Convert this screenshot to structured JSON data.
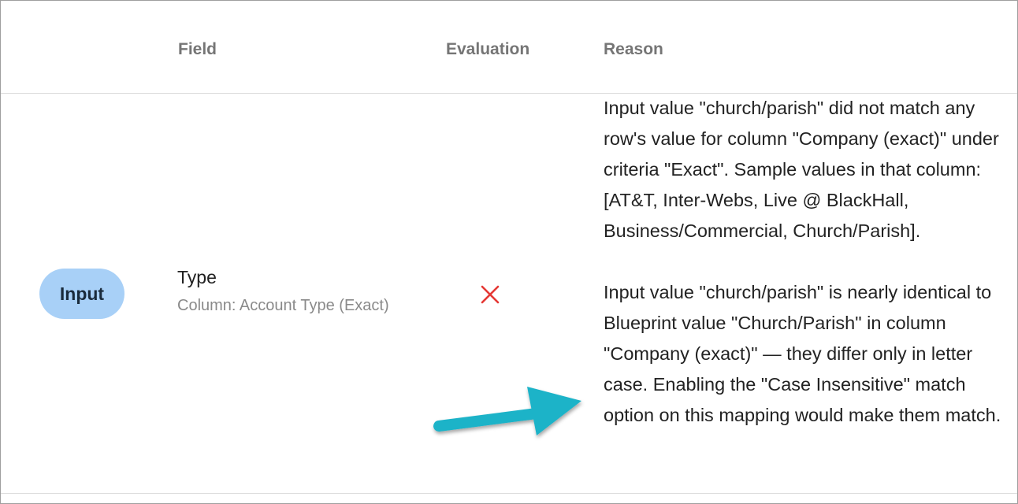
{
  "table": {
    "headers": {
      "field": "Field",
      "evaluation": "Evaluation",
      "reason": "Reason"
    },
    "rows": [
      {
        "badge": "Input",
        "field_name": "Type",
        "field_sub": "Column: Account Type (Exact)",
        "evaluation_icon": "x-icon",
        "evaluation_color": "#e53935",
        "reason_paragraphs": [
          "Input value \"church/parish\" did not match any row's value for column \"Company (exact)\" under criteria \"Exact\". Sample values in that column: [AT&T, Inter-Webs, Live @ BlackHall, Business/Commercial, Church/Parish].",
          "Input value \"church/parish\" is nearly identical to Blueprint value \"Church/Parish\" in column \"Company (exact)\" — they differ only in letter case. Enabling the \"Case Insensitive\" match option on this mapping would make them match."
        ]
      }
    ]
  },
  "annotation": {
    "icon": "arrow-icon",
    "color": "#1fb3c8"
  },
  "colors": {
    "badge_bg": "#a8d0f7",
    "header_text": "#757575",
    "divider": "#dcdcdc"
  }
}
